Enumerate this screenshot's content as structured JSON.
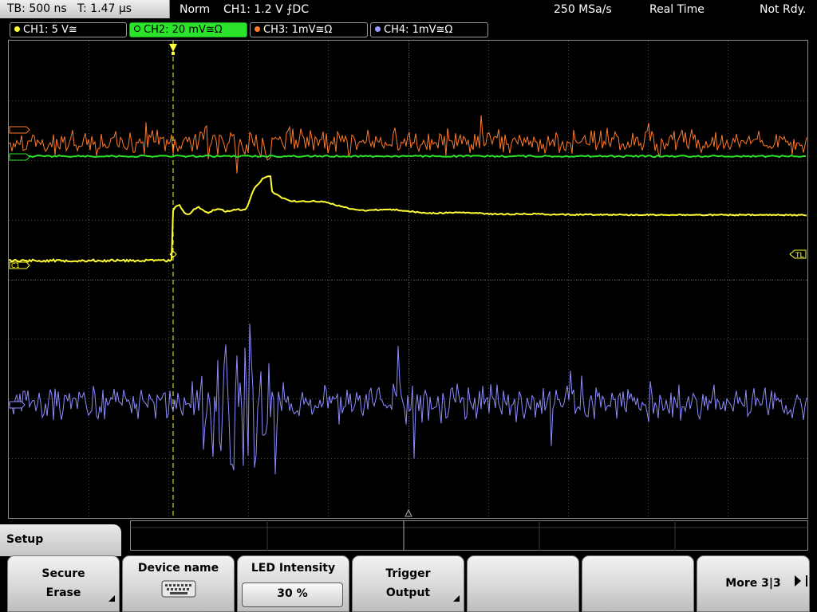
{
  "topbar": {
    "timebase": "TB: 500 ns",
    "trigger_time": "T: 1.47 µs",
    "trigger_mode": "Norm",
    "trigger_setting": "CH1: 1.2 V ⨍DC",
    "sample_rate": "250 MSa/s",
    "acq_mode": "Real Time",
    "status": "Not Rdy."
  },
  "channels": [
    {
      "label": "CH1: 5 V≅",
      "color": "#ffff33",
      "active": false
    },
    {
      "label": "CH2: 20 mV≅Ω",
      "color": "#2be32b",
      "active": true
    },
    {
      "label": "CH3: 1mV≅Ω",
      "color": "#ff7a2b",
      "active": false
    },
    {
      "label": "CH4: 1mV≅Ω",
      "color": "#9a9aff",
      "active": false
    }
  ],
  "screen": {
    "markers": {
      "ch1": "C1",
      "trigger_level": "TL"
    },
    "colors": {
      "ch1": "#ffff33",
      "ch2": "#2be32b",
      "ch3": "#ff7a2b",
      "ch4": "#8c8cff",
      "grid": "#4a4a4a",
      "trigger": "#ffff33"
    }
  },
  "menu": {
    "title": "Setup",
    "softkeys": [
      {
        "line1": "Secure",
        "line2": "Erase",
        "submenu": true
      },
      {
        "line1": "Device name",
        "icon": "keyboard-icon"
      },
      {
        "line1": "LED Intensity",
        "value": "30 %"
      },
      {
        "line1": "Trigger",
        "line2": "Output",
        "submenu": true
      },
      {
        "line1": ""
      },
      {
        "line1": ""
      },
      {
        "line1": "More 3|3"
      }
    ]
  }
}
